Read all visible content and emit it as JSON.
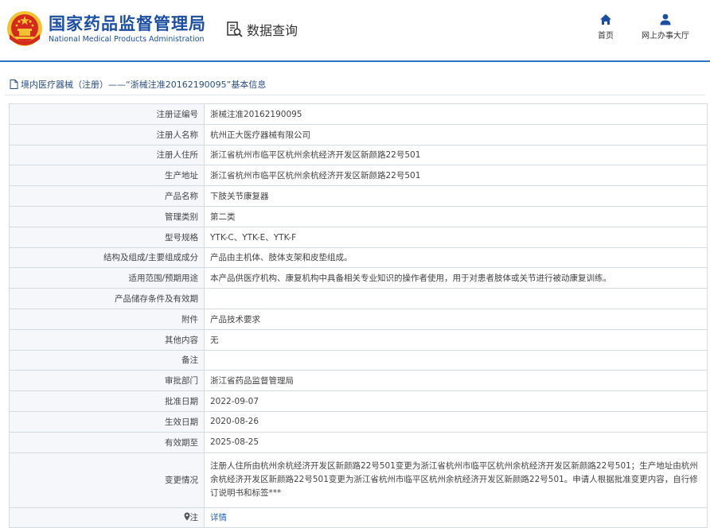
{
  "header": {
    "site_title_cn": "国家药品监督管理局",
    "site_title_en": "National Medical Products Administration",
    "data_query_label": "数据查询",
    "nav": [
      {
        "label": "首页",
        "icon": "home-icon"
      },
      {
        "label": "网上办事大厅",
        "icon": "user-icon"
      }
    ]
  },
  "breadcrumb": {
    "text": "境内医疗器械（注册）——“浙械注准20162190095”基本信息",
    "icon": "document-icon"
  },
  "details": {
    "rows": [
      {
        "label": "注册证编号",
        "value": "浙械注准20162190095"
      },
      {
        "label": "注册人名称",
        "value": "杭州正大医疗器械有限公司"
      },
      {
        "label": "注册人住所",
        "value": "浙江省杭州市临平区杭州余杭经济开发区新颜路22号501"
      },
      {
        "label": "生产地址",
        "value": "浙江省杭州市临平区杭州余杭经济开发区新颜路22号501"
      },
      {
        "label": "产品名称",
        "value": "下肢关节康复器"
      },
      {
        "label": "管理类别",
        "value": "第二类"
      },
      {
        "label": "型号规格",
        "value": "YTK-C、YTK-E、YTK-F"
      },
      {
        "label": "结构及组成/主要组成成分",
        "value": "产品由主机体、肢体支架和皮垫组成。"
      },
      {
        "label": "适用范围/预期用途",
        "value": "本产品供医疗机构、康复机构中具备相关专业知识的操作者使用，用于对患者肢体或关节进行被动康复训练。"
      },
      {
        "label": "产品储存条件及有效期",
        "value": ""
      },
      {
        "label": "附件",
        "value": "产品技术要求"
      },
      {
        "label": "其他内容",
        "value": "无"
      },
      {
        "label": "备注",
        "value": ""
      },
      {
        "label": "审批部门",
        "value": "浙江省药品监督管理局"
      },
      {
        "label": "批准日期",
        "value": "2022-09-07"
      },
      {
        "label": "生效日期",
        "value": "2020-08-26"
      },
      {
        "label": "有效期至",
        "value": "2025-08-25"
      }
    ],
    "change": {
      "label": "变更情况",
      "value": "注册人住所由杭州余杭经济开发区新颜路22号501变更为浙江省杭州市临平区杭州余杭经济开发区新颜路22号501；生产地址由杭州余杭经济开发区新颜路22号501变更为浙江省杭州市临平区杭州余杭经济开发区新颜路22号501。申请人根据批准变更内容，自行修订说明书和标签***"
    },
    "note": {
      "label": "注",
      "icon": "pin-icon",
      "link": "详情"
    }
  },
  "colors": {
    "brand_blue": "#1c4fa3",
    "header_rule": "#2f73c7",
    "emblem_red": "#d42a1e",
    "emblem_gold": "#f2c230",
    "label_bg": "#f5f7fa",
    "border": "#d5dbe3",
    "link": "#2a68c2"
  }
}
